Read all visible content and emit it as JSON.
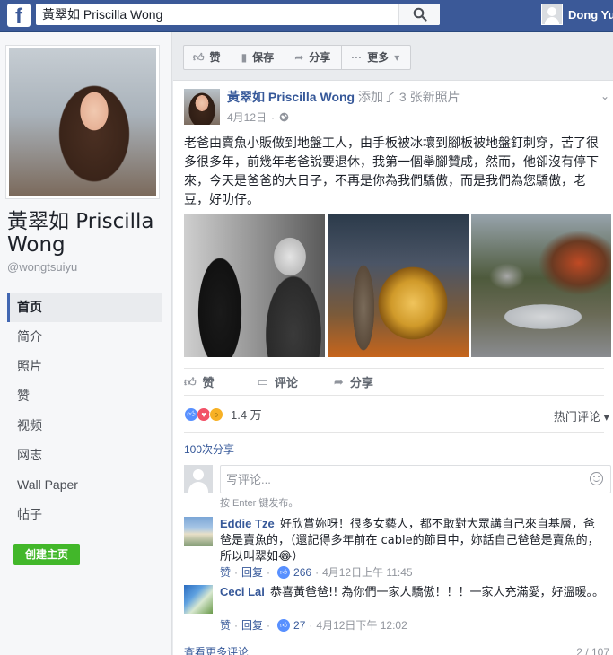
{
  "topbar": {
    "logo": "f",
    "search_value": "黃翠如 Priscilla Wong",
    "user_name": "Dong Yu",
    "brand_color": "#3b5998"
  },
  "sidebar": {
    "page_name": "黃翠如 Priscilla Wong",
    "handle": "@wongtsuiyu",
    "items": [
      {
        "label": "首页",
        "active": true
      },
      {
        "label": "简介"
      },
      {
        "label": "照片"
      },
      {
        "label": "赞"
      },
      {
        "label": "视频"
      },
      {
        "label": "网志"
      },
      {
        "label": "Wall Paper"
      },
      {
        "label": "帖子"
      }
    ],
    "create_page_label": "创建主页"
  },
  "page_actions": [
    {
      "label": "赞",
      "icon": "thumbs-up-icon"
    },
    {
      "label": "保存",
      "icon": "bookmark-icon"
    },
    {
      "label": "分享",
      "icon": "share-arrow-icon"
    },
    {
      "label": "更多",
      "icon": "dots-icon"
    }
  ],
  "post": {
    "author": "黃翠如 Priscilla Wong",
    "action_text": "添加了 3 张新照片",
    "date": "4月12日",
    "privacy_dot": "·",
    "text": "老爸由賣魚小販做到地盤工人，由手板被冰壞到腳板被地盤釘刺穿，苦了很多很多年，前幾年老爸說要退休，我第一個舉腳贊成，然而，他卻沒有停下來，今天是爸爸的大日子，不再是你為我們驕傲，而是我們為您驕傲，老豆，好叻仔。",
    "actions": [
      {
        "label": "赞",
        "icon": "thumbs-up-icon"
      },
      {
        "label": "评论",
        "icon": "comment-icon"
      },
      {
        "label": "分享",
        "icon": "share-arrow-icon"
      }
    ],
    "reaction_count": "1.4 万",
    "top_comments_label": "热门评论",
    "shares": "100次分享",
    "comment_placeholder": "写评论...",
    "enter_hint": "按 Enter 键发布。"
  },
  "comments": [
    {
      "author": "Eddie Tze",
      "text": "好欣賞妳呀！很多女藝人，都不敢對大眾講自己來自基層，爸爸是賣魚的，（還記得多年前在 cable的節目中，妳話自己爸爸是賣魚的，所以叫翠如😂）",
      "like": "赞",
      "reply": "回复",
      "likes": "266",
      "time": "4月12日上午 11:45"
    },
    {
      "author": "Ceci Lai",
      "text": "恭喜黃爸爸!! 為你們一家人驕傲！！！一家人充滿愛，好溫暖。。",
      "like": "赞",
      "reply": "回复",
      "likes": "27",
      "time": "4月12日下午 12:02"
    }
  ],
  "footer": {
    "view_more": "查看更多评论",
    "page_count": "2 / 107"
  }
}
